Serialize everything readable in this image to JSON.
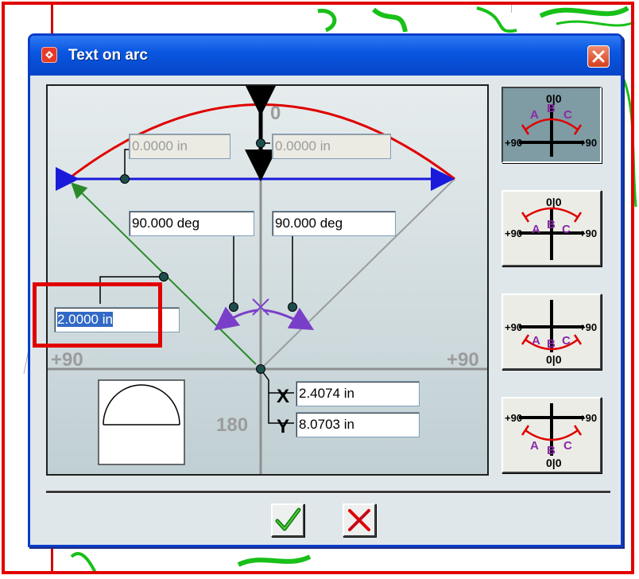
{
  "window": {
    "title": "Text on arc",
    "app_icon": "app-logo-icon",
    "close_icon": "close-icon"
  },
  "arc_editor": {
    "top_label": "0",
    "bottom_label": "180",
    "left_label": "+90",
    "right_label": "+90",
    "height_left_value": "0.0000 in",
    "height_right_value": "0.0000 in",
    "left_angle_value": "90.000 deg",
    "right_angle_value": "90.000 deg",
    "radius_value": "2.0000 in",
    "x_label": "X",
    "x_value": "2.4074 in",
    "y_label": "Y",
    "y_value": "8.0703 in"
  },
  "layout_buttons": [
    {
      "name": "text-above-arc-outside",
      "top": "0|0",
      "left": "+90",
      "right": "+90",
      "letters": [
        "A",
        "B",
        "C"
      ],
      "pressed": true
    },
    {
      "name": "text-above-arc-inside",
      "top": "0|0",
      "left": "+90",
      "right": "+90",
      "letters": [
        "A",
        "B",
        "C"
      ],
      "pressed": false
    },
    {
      "name": "text-below-arc-inside",
      "bottom": "0|0",
      "left": "+90",
      "right": "+90",
      "letters": [
        "A",
        "B",
        "C"
      ],
      "pressed": false
    },
    {
      "name": "text-below-arc-outside",
      "bottom": "0|0",
      "left": "+90",
      "right": "+90",
      "letters": [
        "A",
        "B",
        "C"
      ],
      "pressed": false
    }
  ],
  "actions": {
    "ok_icon": "checkmark-icon",
    "cancel_icon": "red-x-icon"
  },
  "colors": {
    "titlebar": "#0a57e1",
    "arc": "#e00000",
    "chord": "#1a1adb",
    "radius_line": "#2a8a2a",
    "angle_arcs": "#7a3fc8",
    "letters": "#8a2aa8",
    "highlight": "#e10000"
  }
}
